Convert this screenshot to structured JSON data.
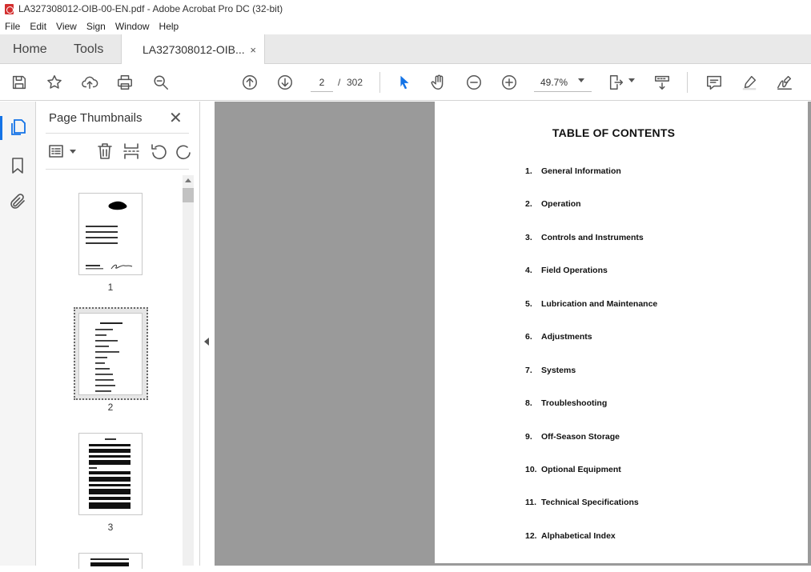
{
  "window": {
    "title": "LA327308012-OIB-00-EN.pdf - Adobe Acrobat Pro DC (32-bit)"
  },
  "menu": [
    "File",
    "Edit",
    "View",
    "Sign",
    "Window",
    "Help"
  ],
  "tabs": {
    "home": "Home",
    "tools": "Tools",
    "document": "LA327308012-OIB...",
    "close": "×"
  },
  "toolbar": {
    "current_page": "2",
    "separator": "/",
    "total_pages": "302",
    "zoom": "49.7%"
  },
  "thumbnails_panel": {
    "title": "Page Thumbnails",
    "close": "✕",
    "pages": [
      "1",
      "2",
      "3"
    ],
    "selected_page": "2"
  },
  "document": {
    "heading": "TABLE OF CONTENTS",
    "toc": [
      {
        "num": "1.",
        "label": "General Information"
      },
      {
        "num": "2.",
        "label": "Operation"
      },
      {
        "num": "3.",
        "label": "Controls and Instruments"
      },
      {
        "num": "4.",
        "label": "Field Operations"
      },
      {
        "num": "5.",
        "label": "Lubrication and Maintenance"
      },
      {
        "num": "6.",
        "label": "Adjustments"
      },
      {
        "num": "7.",
        "label": "Systems"
      },
      {
        "num": "8.",
        "label": "Troubleshooting"
      },
      {
        "num": "9.",
        "label": "Off-Season Storage"
      },
      {
        "num": "10.",
        "label": "Optional Equipment"
      },
      {
        "num": "11.",
        "label": "Technical Specifications"
      },
      {
        "num": "12.",
        "label": "Alphabetical Index"
      }
    ]
  },
  "colors": {
    "accent": "#1473e6",
    "doc_background": "#9a9a9a",
    "tab_bar": "#e9e9e9",
    "pdf_icon": "#d32f2f"
  },
  "icons": [
    "save-icon",
    "star-icon",
    "upload-icon",
    "print-icon",
    "zoom-search-icon",
    "page-up-icon",
    "page-down-icon",
    "select-arrow-icon",
    "hand-icon",
    "zoom-out-icon",
    "zoom-in-icon",
    "fit-page-icon",
    "scroll-mode-icon",
    "comment-icon",
    "highlight-icon",
    "sign-icon",
    "pages-icon",
    "bookmark-icon",
    "attachment-icon",
    "options-icon",
    "trash-icon",
    "insert-icon",
    "undo-icon",
    "redo-icon"
  ]
}
